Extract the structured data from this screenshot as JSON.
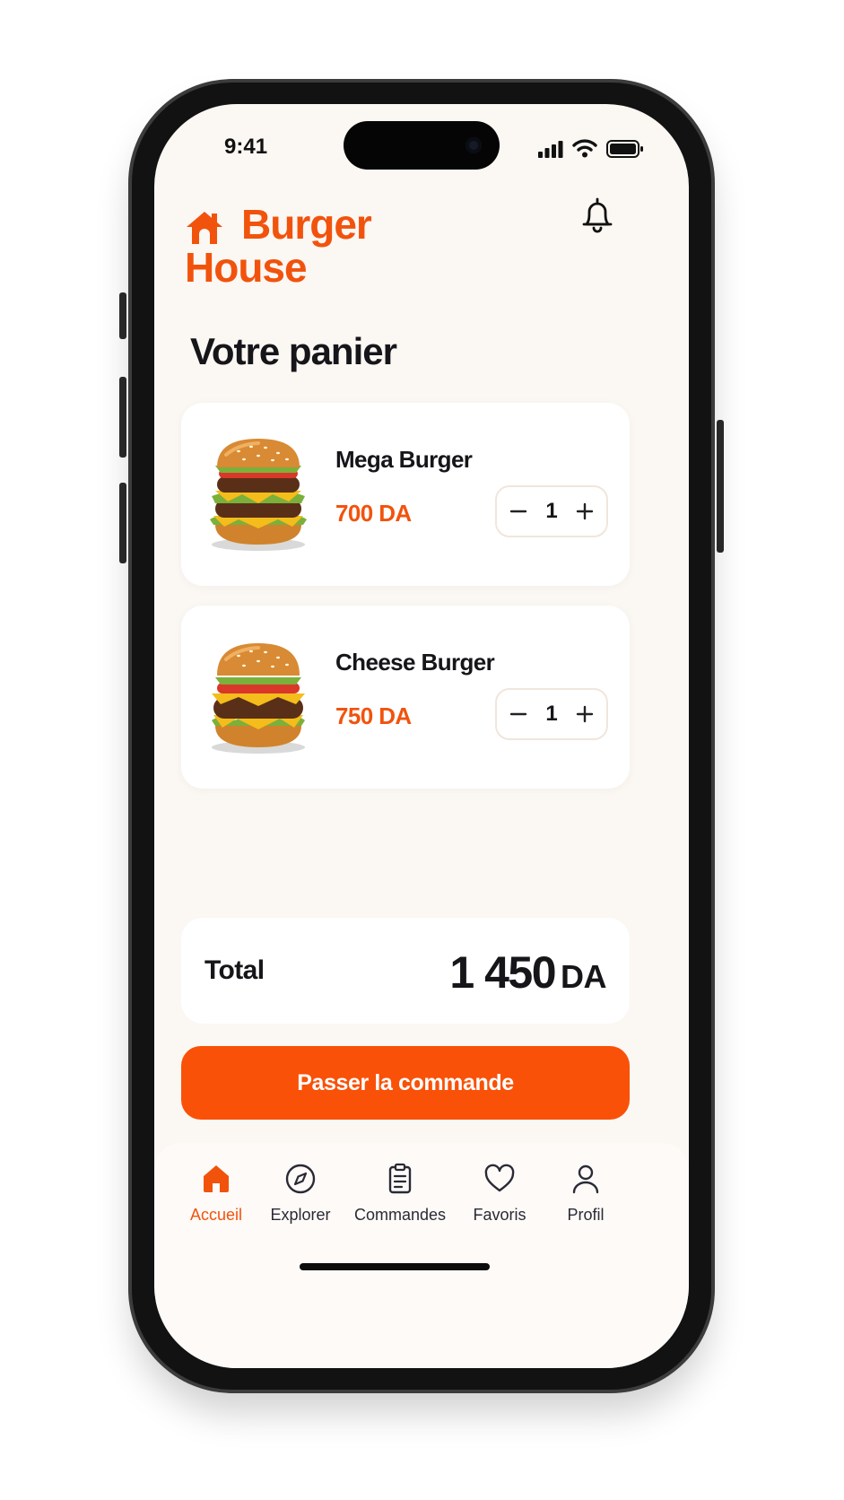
{
  "status_bar": {
    "time": "9:41"
  },
  "brand": {
    "name": "Burger House"
  },
  "page": {
    "title": "Votre panier"
  },
  "cart": {
    "items": [
      {
        "name": "Mega Burger",
        "price": "700 DA",
        "quantity": "1"
      },
      {
        "name": "Cheese Burger",
        "price": "750 DA",
        "quantity": "1"
      }
    ],
    "total_label": "Total",
    "total_amount": "1 450",
    "total_currency": "DA"
  },
  "actions": {
    "order_button": "Passer la commande"
  },
  "bottom_nav": {
    "items": [
      {
        "label": "Accueil",
        "icon": "home-icon",
        "active": true
      },
      {
        "label": "Explorer",
        "icon": "compass-icon",
        "active": false
      },
      {
        "label": "Commandes",
        "icon": "clipboard-icon",
        "active": false
      },
      {
        "label": "Favoris",
        "icon": "heart-icon",
        "active": false
      },
      {
        "label": "Profil",
        "icon": "user-icon",
        "active": false
      }
    ]
  },
  "colors": {
    "accent": "#f1530d",
    "button": "#f95108",
    "background": "#fbf7f3",
    "card": "#ffffff"
  }
}
